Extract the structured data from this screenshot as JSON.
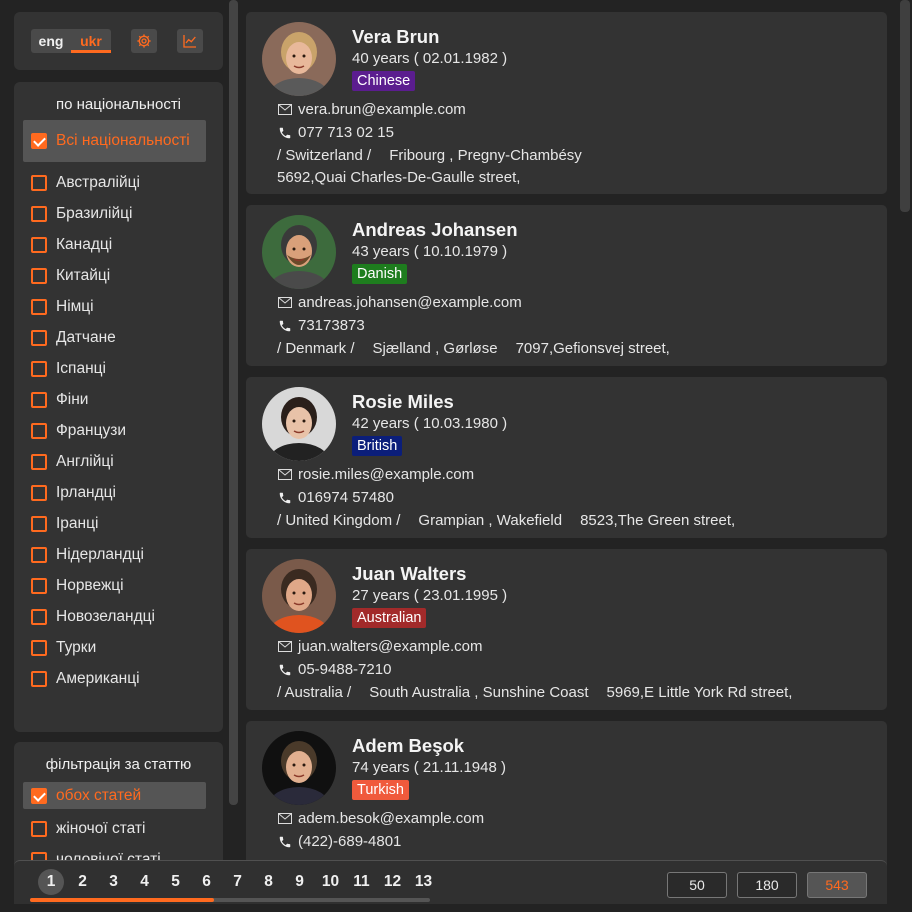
{
  "lang": {
    "eng": "eng",
    "ukr": "ukr"
  },
  "nationality_filter": {
    "title": "по національності",
    "items": [
      {
        "label": "Всі національності",
        "checked": true
      },
      {
        "label": "Австралійці",
        "checked": false
      },
      {
        "label": "Бразилійці",
        "checked": false
      },
      {
        "label": "Канадці",
        "checked": false
      },
      {
        "label": "Китайці",
        "checked": false
      },
      {
        "label": "Німці",
        "checked": false
      },
      {
        "label": "Датчане",
        "checked": false
      },
      {
        "label": "Іспанці",
        "checked": false
      },
      {
        "label": "Фіни",
        "checked": false
      },
      {
        "label": "Французи",
        "checked": false
      },
      {
        "label": "Англійці",
        "checked": false
      },
      {
        "label": "Ірландці",
        "checked": false
      },
      {
        "label": "Іранці",
        "checked": false
      },
      {
        "label": "Нідерландці",
        "checked": false
      },
      {
        "label": "Норвежці",
        "checked": false
      },
      {
        "label": "Новозеландці",
        "checked": false
      },
      {
        "label": "Турки",
        "checked": false
      },
      {
        "label": "Американці",
        "checked": false
      }
    ]
  },
  "gender_filter": {
    "title": "фільтрація за статтю",
    "items": [
      {
        "label": "обох статей",
        "checked": true
      },
      {
        "label": "жіночої статі",
        "checked": false
      },
      {
        "label": "чоловічої статі",
        "checked": false
      }
    ]
  },
  "users": [
    {
      "name": "Vera Brun",
      "age": "40 years ( 02.01.1982 )",
      "nat": "Chinese",
      "nat_color": "#5b1d8f",
      "email": "vera.brun@example.com",
      "phone": "077 713 02 15",
      "country": "/ Switzerland /",
      "city": "Fribourg , Pregny-Chambésy",
      "street": "5692,Quai Charles-De-Gaulle street,"
    },
    {
      "name": "Andreas Johansen",
      "age": "43 years ( 10.10.1979 )",
      "nat": "Danish",
      "nat_color": "#1e7d1e",
      "email": "andreas.johansen@example.com",
      "phone": "73173873",
      "country": "/ Denmark /",
      "city": "Sjælland , Gørløse",
      "street": "7097,Gefionsvej street,"
    },
    {
      "name": "Rosie Miles",
      "age": "42 years ( 10.03.1980 )",
      "nat": "British",
      "nat_color": "#0b1e7a",
      "email": "rosie.miles@example.com",
      "phone": "016974 57480",
      "country": "/ United Kingdom /",
      "city": "Grampian , Wakefield",
      "street": "8523,The Green street,"
    },
    {
      "name": "Juan Walters",
      "age": "27 years ( 23.01.1995 )",
      "nat": "Australian",
      "nat_color": "#a22a2a",
      "email": "juan.walters@example.com",
      "phone": "05-9488-7210",
      "country": "/ Australia /",
      "city": "South Australia , Sunshine Coast",
      "street": "5969,E Little York Rd street,"
    },
    {
      "name": "Adem Beşok",
      "age": "74 years ( 21.11.1948 )",
      "nat": "Turkish",
      "nat_color": "#f05a3c",
      "email": "adem.besok@example.com",
      "phone": "(422)-689-4801",
      "country": "",
      "city": "",
      "street": ""
    }
  ],
  "pagination": {
    "pages": [
      "1",
      "2",
      "3",
      "4",
      "5",
      "6",
      "7",
      "8",
      "9",
      "10",
      "11",
      "12",
      "13"
    ],
    "current": "1",
    "progress": 0.46
  },
  "page_sizes": [
    "50",
    "180",
    "543"
  ],
  "active_page_size": "543"
}
